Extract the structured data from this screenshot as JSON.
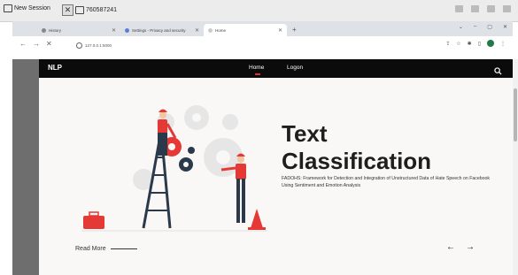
{
  "session": {
    "new_session_label": "New Session",
    "session_id": "760587241"
  },
  "browser": {
    "tabs": [
      {
        "title": "History",
        "active": false
      },
      {
        "title": "Settings - Privacy and security",
        "active": false
      },
      {
        "title": "Home",
        "active": true
      }
    ],
    "url": "127.0.0.1:5000"
  },
  "site": {
    "brand": "NLP",
    "nav": [
      {
        "label": "Home",
        "active": true
      },
      {
        "label": "Logon",
        "active": false
      }
    ],
    "hero": {
      "title_line1": "Text",
      "title_line2": "Classification",
      "subtitle": "FADOHS: Framework for Detection and Integration of Unstructured Data of Hate Speech on Facebook Using Sentiment and Emotion Analysis",
      "read_more": "Read More"
    },
    "colors": {
      "accent": "#e03030",
      "nav_bg": "#0b0b0b",
      "hero_bg": "#f9f8f6"
    }
  }
}
